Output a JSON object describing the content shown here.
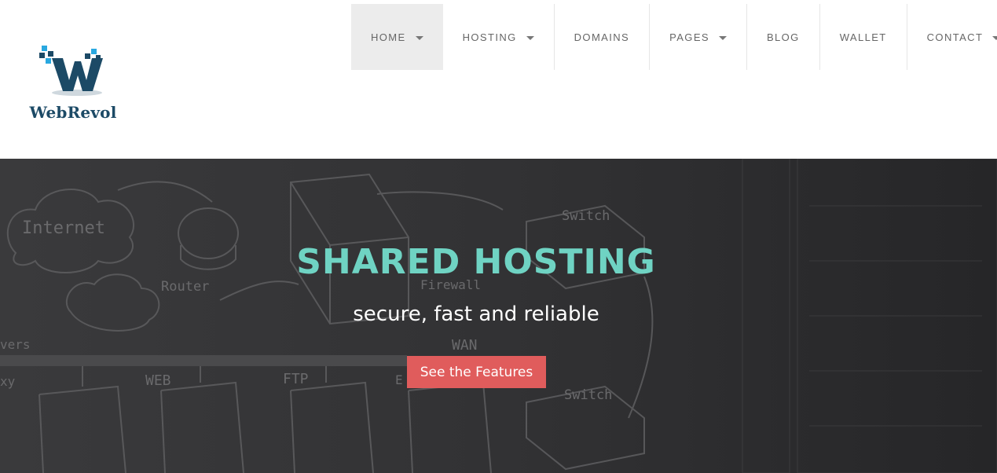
{
  "brand": {
    "name": "WebRevol",
    "logo_icon": "pixel-w-logo-icon",
    "colors": {
      "logo_text": "#1c4a66",
      "logo_pixels": "#29a8e0"
    }
  },
  "nav": {
    "items": [
      {
        "label": "HOME",
        "has_dropdown": true,
        "active": true
      },
      {
        "label": "HOSTING",
        "has_dropdown": true,
        "active": false
      },
      {
        "label": "DOMAINS",
        "has_dropdown": false,
        "active": false
      },
      {
        "label": "PAGES",
        "has_dropdown": true,
        "active": false
      },
      {
        "label": "BLOG",
        "has_dropdown": false,
        "active": false
      },
      {
        "label": "WALLET",
        "has_dropdown": false,
        "active": false
      },
      {
        "label": "CONTACT",
        "has_dropdown": true,
        "active": false
      }
    ]
  },
  "hero": {
    "title": "SHARED HOSTING",
    "subtitle": "secure, fast and reliable",
    "cta_label": "See the Features",
    "background_sketch_labels": [
      "Internet",
      "Router",
      "Switch",
      "Firewall",
      "WAN",
      "Switch",
      "WEB",
      "FTP",
      "vers",
      "xy",
      "E"
    ],
    "colors": {
      "title": "#6fd3c3",
      "cta": "#e05c5c",
      "background": "#2e2e30"
    }
  }
}
